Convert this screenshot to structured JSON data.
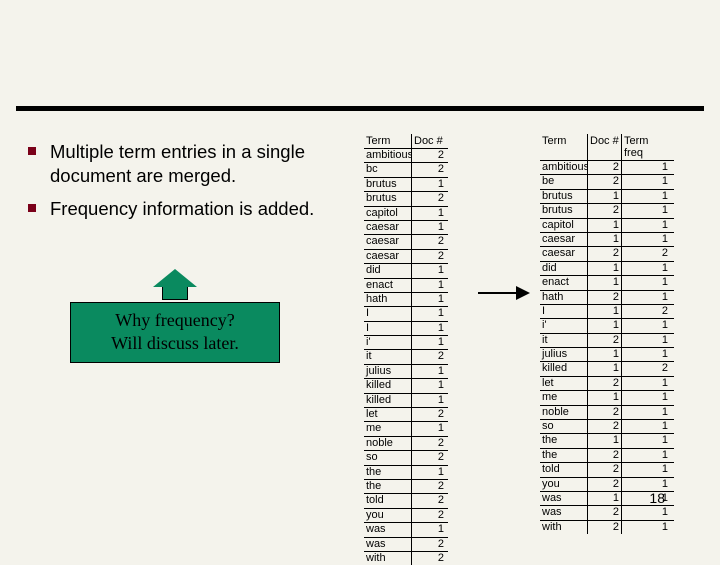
{
  "bullets": {
    "b0": "Multiple term entries in a single document are merged.",
    "b1": "Frequency information is added."
  },
  "callout": {
    "line1": "Why frequency?",
    "line2": "Will discuss later."
  },
  "table_left": {
    "headers": {
      "term": "Term",
      "doc": "Doc #"
    },
    "rows": [
      {
        "term": "ambitious",
        "doc": "2"
      },
      {
        "term": "bc",
        "doc": "2"
      },
      {
        "term": "brutus",
        "doc": "1"
      },
      {
        "term": "brutus",
        "doc": "2"
      },
      {
        "term": "capitol",
        "doc": "1"
      },
      {
        "term": "caesar",
        "doc": "1"
      },
      {
        "term": "caesar",
        "doc": "2"
      },
      {
        "term": "caesar",
        "doc": "2"
      },
      {
        "term": "did",
        "doc": "1"
      },
      {
        "term": "enact",
        "doc": "1"
      },
      {
        "term": "hath",
        "doc": "1"
      },
      {
        "term": "I",
        "doc": "1"
      },
      {
        "term": "I",
        "doc": "1"
      },
      {
        "term": "i'",
        "doc": "1"
      },
      {
        "term": "it",
        "doc": "2"
      },
      {
        "term": "julius",
        "doc": "1"
      },
      {
        "term": "killed",
        "doc": "1"
      },
      {
        "term": "killed",
        "doc": "1"
      },
      {
        "term": "let",
        "doc": "2"
      },
      {
        "term": "me",
        "doc": "1"
      },
      {
        "term": "noble",
        "doc": "2"
      },
      {
        "term": "so",
        "doc": "2"
      },
      {
        "term": "the",
        "doc": "1"
      },
      {
        "term": "the",
        "doc": "2"
      },
      {
        "term": "told",
        "doc": "2"
      },
      {
        "term": "you",
        "doc": "2"
      },
      {
        "term": "was",
        "doc": "1"
      },
      {
        "term": "was",
        "doc": "2"
      },
      {
        "term": "with",
        "doc": "2"
      }
    ]
  },
  "table_right": {
    "headers": {
      "term": "Term",
      "doc": "Doc #",
      "freq": "Term freq"
    },
    "rows": [
      {
        "term": "ambitious",
        "doc": "2",
        "freq": "1"
      },
      {
        "term": "be",
        "doc": "2",
        "freq": "1"
      },
      {
        "term": "brutus",
        "doc": "1",
        "freq": "1"
      },
      {
        "term": "brutus",
        "doc": "2",
        "freq": "1"
      },
      {
        "term": "capitol",
        "doc": "1",
        "freq": "1"
      },
      {
        "term": "caesar",
        "doc": "1",
        "freq": "1"
      },
      {
        "term": "caesar",
        "doc": "2",
        "freq": "2"
      },
      {
        "term": "did",
        "doc": "1",
        "freq": "1"
      },
      {
        "term": "enact",
        "doc": "1",
        "freq": "1"
      },
      {
        "term": "hath",
        "doc": "2",
        "freq": "1"
      },
      {
        "term": "I",
        "doc": "1",
        "freq": "2"
      },
      {
        "term": "i'",
        "doc": "1",
        "freq": "1"
      },
      {
        "term": "it",
        "doc": "2",
        "freq": "1"
      },
      {
        "term": "julius",
        "doc": "1",
        "freq": "1"
      },
      {
        "term": "killed",
        "doc": "1",
        "freq": "2"
      },
      {
        "term": "let",
        "doc": "2",
        "freq": "1"
      },
      {
        "term": "me",
        "doc": "1",
        "freq": "1"
      },
      {
        "term": "noble",
        "doc": "2",
        "freq": "1"
      },
      {
        "term": "so",
        "doc": "2",
        "freq": "1"
      },
      {
        "term": "the",
        "doc": "1",
        "freq": "1"
      },
      {
        "term": "the",
        "doc": "2",
        "freq": "1"
      },
      {
        "term": "told",
        "doc": "2",
        "freq": "1"
      },
      {
        "term": "you",
        "doc": "2",
        "freq": "1"
      },
      {
        "term": "was",
        "doc": "1",
        "freq": "1"
      },
      {
        "term": "was",
        "doc": "2",
        "freq": "1"
      },
      {
        "term": "with",
        "doc": "2",
        "freq": "1"
      }
    ]
  },
  "page_number": "18"
}
